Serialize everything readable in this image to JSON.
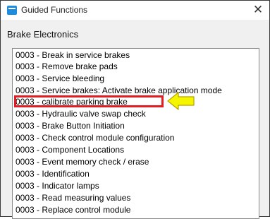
{
  "window": {
    "title": "Guided Functions",
    "close_glyph": "✕"
  },
  "section": {
    "title": "Brake Electronics"
  },
  "list": {
    "items": [
      "0003  - Break in service brakes",
      "0003  - Remove brake pads",
      "0003  - Service bleeding",
      "0003  - Service brakes: Activate brake application mode",
      "0003  - calibrate parking brake",
      "0003  - Hydraulic valve swap check",
      "0003 - Brake Button Initiation",
      "0003 - Check control module configuration",
      "0003 - Component Locations",
      "0003 - Event memory check / erase",
      "0003 - Identification",
      "0003 - Indicator lamps",
      "0003 - Read measuring values",
      "0003 - Replace control module"
    ],
    "highlighted_index": 4
  },
  "annotation": {
    "highlight_color": "#e31b23",
    "arrow_color": "#f5f500",
    "arrow_outline_color": "#b5a300"
  }
}
